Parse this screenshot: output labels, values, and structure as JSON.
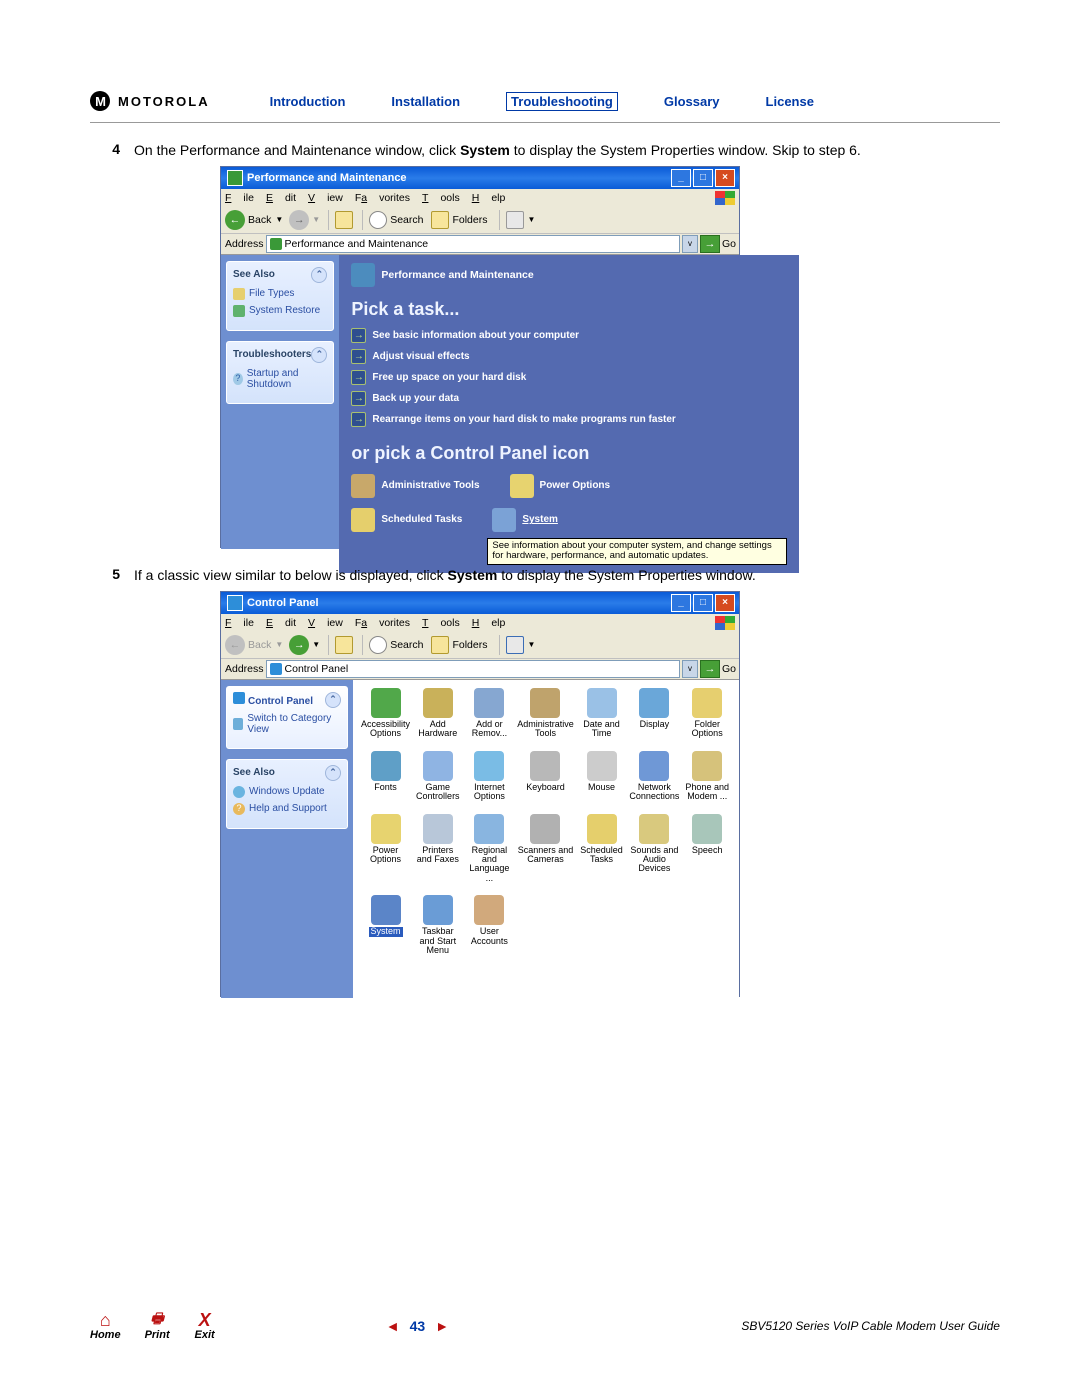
{
  "header": {
    "brand": "MOTOROLA",
    "nav": [
      "Introduction",
      "Installation",
      "Troubleshooting",
      "Glossary",
      "License"
    ],
    "active_nav": "Troubleshooting"
  },
  "steps": {
    "s4": {
      "num": "4",
      "text_a": "On the Performance and Maintenance window, click ",
      "bold": "System",
      "text_b": " to display the System Properties window. Skip to step 6."
    },
    "s5": {
      "num": "5",
      "text_a": "If a classic view similar to below is displayed, click ",
      "bold": "System",
      "text_b": " to display the System Properties window."
    }
  },
  "win1": {
    "title": "Performance and Maintenance",
    "menus": [
      "File",
      "Edit",
      "View",
      "Favorites",
      "Tools",
      "Help"
    ],
    "toolbar": {
      "back": "Back",
      "search": "Search",
      "folders": "Folders"
    },
    "address_label": "Address",
    "address_value": "Performance and Maintenance",
    "go": "Go",
    "side": {
      "see_also": "See Also",
      "sa_items": [
        "File Types",
        "System Restore"
      ],
      "troubleshooters": "Troubleshooters",
      "ts_items": [
        "Startup and Shutdown"
      ]
    },
    "cat_head": "Performance and Maintenance",
    "pick_task": "Pick a task...",
    "tasks": [
      "See basic information about your computer",
      "Adjust visual effects",
      "Free up space on your hard disk",
      "Back up your data",
      "Rearrange items on your hard disk to make programs run faster"
    ],
    "or_pick": "or pick a Control Panel icon",
    "icons": {
      "admin": "Administrative Tools",
      "power": "Power Options",
      "sched": "Scheduled Tasks",
      "system": "System"
    },
    "tooltip": "See information about your computer system, and change settings for hardware, performance, and automatic updates."
  },
  "win2": {
    "title": "Control Panel",
    "menus": [
      "File",
      "Edit",
      "View",
      "Favorites",
      "Tools",
      "Help"
    ],
    "toolbar": {
      "back": "Back",
      "search": "Search",
      "folders": "Folders"
    },
    "address_label": "Address",
    "address_value": "Control Panel",
    "go": "Go",
    "side": {
      "cp": "Control Panel",
      "switch": "Switch to Category View",
      "see_also": "See Also",
      "sa_items": [
        "Windows Update",
        "Help and Support"
      ]
    },
    "grid": [
      {
        "n": "Accessibility Options",
        "c": "#51a84a"
      },
      {
        "n": "Add Hardware",
        "c": "#c9b15a"
      },
      {
        "n": "Add or Remov...",
        "c": "#86a7d1"
      },
      {
        "n": "Administrative Tools",
        "c": "#bfa36c"
      },
      {
        "n": "Date and Time",
        "c": "#9ac1e6"
      },
      {
        "n": "Display",
        "c": "#6aa7d9"
      },
      {
        "n": "Folder Options",
        "c": "#e6cf6f"
      },
      {
        "n": "Fonts",
        "c": "#5f9fc7"
      },
      {
        "n": "Game Controllers",
        "c": "#8fb4e3"
      },
      {
        "n": "Internet Options",
        "c": "#7abce5"
      },
      {
        "n": "Keyboard",
        "c": "#b8b8b8"
      },
      {
        "n": "Mouse",
        "c": "#cccccc"
      },
      {
        "n": "Network Connections",
        "c": "#6f98d6"
      },
      {
        "n": "Phone and Modem ...",
        "c": "#d6c27b"
      },
      {
        "n": "Power Options",
        "c": "#e7d36f"
      },
      {
        "n": "Printers and Faxes",
        "c": "#b8c7d9"
      },
      {
        "n": "Regional and Language ...",
        "c": "#89b5e0"
      },
      {
        "n": "Scanners and Cameras",
        "c": "#b1b1b1"
      },
      {
        "n": "Scheduled Tasks",
        "c": "#e5cf6c"
      },
      {
        "n": "Sounds and Audio Devices",
        "c": "#d9c97e"
      },
      {
        "n": "Speech",
        "c": "#a8c6ba"
      },
      {
        "n": "System",
        "c": "#5b85c8",
        "sel": true
      },
      {
        "n": "Taskbar and Start Menu",
        "c": "#6a9cd6"
      },
      {
        "n": "User Accounts",
        "c": "#d1a97c"
      }
    ]
  },
  "footer": {
    "home": "Home",
    "print": "Print",
    "exit": "Exit",
    "page": "43",
    "guide": "SBV5120 Series VoIP Cable Modem User Guide"
  }
}
